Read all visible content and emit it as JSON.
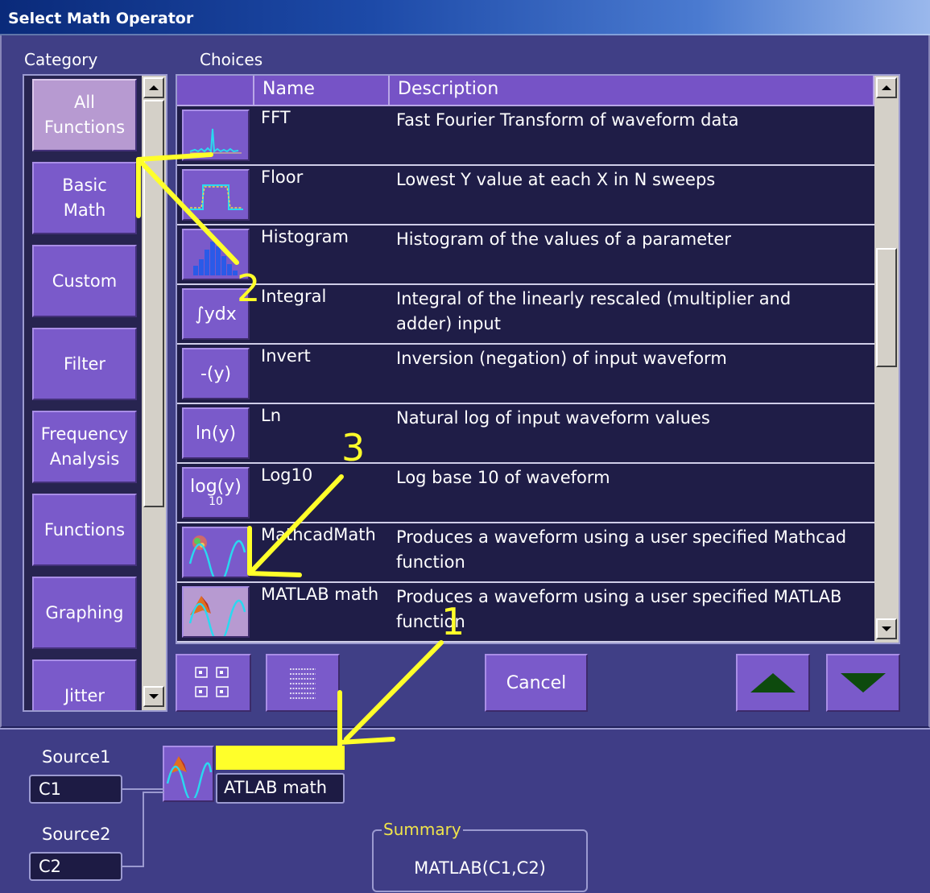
{
  "window": {
    "title": "Select Math Operator"
  },
  "labels": {
    "category": "Category",
    "choices": "Choices"
  },
  "categories": [
    {
      "label": "All\nFunctions",
      "selected": true
    },
    {
      "label": "Basic\nMath",
      "selected": false
    },
    {
      "label": "Custom",
      "selected": false
    },
    {
      "label": "Filter",
      "selected": false
    },
    {
      "label": "Frequency\nAnalysis",
      "selected": false
    },
    {
      "label": "Functions",
      "selected": false
    },
    {
      "label": "Graphing",
      "selected": false
    },
    {
      "label": "Jitter",
      "selected": false
    }
  ],
  "columns": {
    "name": "Name",
    "description": "Description"
  },
  "rows": [
    {
      "name": "FFT",
      "description": "Fast Fourier Transform of waveform data",
      "icon": "fft-icon",
      "icon_text": ""
    },
    {
      "name": "Floor",
      "description": "Lowest Y value at each X in N sweeps",
      "icon": "floor-waveform-icon",
      "icon_text": ""
    },
    {
      "name": "Histogram",
      "description": "Histogram of the values of a parameter",
      "icon": "histogram-icon",
      "icon_text": ""
    },
    {
      "name": "Integral",
      "description": "Integral of the linearly rescaled (multiplier and adder) input",
      "icon": "integral-icon",
      "icon_text": "∫ydx"
    },
    {
      "name": "Invert",
      "description": "Inversion (negation) of input waveform",
      "icon": "invert-icon",
      "icon_text": "-(y)"
    },
    {
      "name": "Ln",
      "description": "Natural log of input waveform values",
      "icon": "ln-icon",
      "icon_text": "ln(y)"
    },
    {
      "name": "Log10",
      "description": "Log base 10 of waveform",
      "icon": "log10-icon",
      "icon_text": "log(y)"
    },
    {
      "name": "MathcadMath",
      "description": "Produces a waveform using a user specified Mathcad function",
      "icon": "mathcad-icon",
      "icon_text": ""
    },
    {
      "name": "MATLAB math",
      "description": "Produces a waveform using a user specified MATLAB function",
      "icon": "matlab-icon",
      "icon_text": "",
      "selected": true
    }
  ],
  "icon_subscripts": {
    "log10": "10"
  },
  "toolbar": {
    "cancel_label": "Cancel"
  },
  "sources": {
    "source1_label": "Source1",
    "source1_value": "C1",
    "source2_label": "Source2",
    "source2_value": "C2"
  },
  "operator": {
    "value": "ATLAB math"
  },
  "summary": {
    "title": "Summary",
    "value": "MATLAB(C1,C2)"
  },
  "annotations": {
    "one": "1",
    "two": "2",
    "three": "3"
  },
  "colors": {
    "accent_purple": "#7a5aca",
    "selected_lavender": "#b79ad1",
    "annotation_yellow": "#ffff2a",
    "dark_bg": "#1f1d47"
  }
}
